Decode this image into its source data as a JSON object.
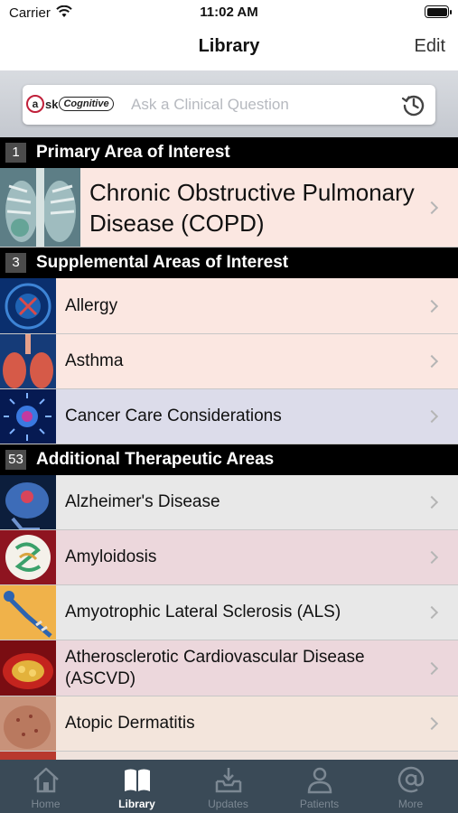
{
  "status_bar": {
    "carrier": "Carrier",
    "time": "11:02 AM"
  },
  "nav": {
    "title": "Library",
    "edit_label": "Edit"
  },
  "search": {
    "logo_prefix": "sk",
    "logo_badge": "Cognitive",
    "placeholder": "Ask a Clinical Question"
  },
  "sections": [
    {
      "count": "1",
      "title": "Primary Area of Interest",
      "items": [
        {
          "label": "Chronic Obstructive Pulmonary Disease (COPD)",
          "bg": "#fbe7e1"
        }
      ]
    },
    {
      "count": "3",
      "title": "Supplemental Areas of Interest",
      "items": [
        {
          "label": "Allergy",
          "bg": "#fbe7e1"
        },
        {
          "label": "Asthma",
          "bg": "#fbe7e1"
        },
        {
          "label": "Cancer Care Considerations",
          "bg": "#dcdcea"
        }
      ]
    },
    {
      "count": "53",
      "title": "Additional Therapeutic Areas",
      "items": [
        {
          "label": "Alzheimer's Disease",
          "bg": "#e8e8e8"
        },
        {
          "label": "Amyloidosis",
          "bg": "#ecd7dc"
        },
        {
          "label": "Amyotrophic Lateral Sclerosis (ALS)",
          "bg": "#e8e8e8"
        },
        {
          "label": "Atherosclerotic Cardiovascular Disease (ASCVD)",
          "bg": "#ecd7dc"
        },
        {
          "label": "Atopic Dermatitis",
          "bg": "#f3e5dc"
        }
      ]
    }
  ],
  "tabs": [
    {
      "label": "Home",
      "icon": "home-icon"
    },
    {
      "label": "Library",
      "icon": "book-icon",
      "active": true
    },
    {
      "label": "Updates",
      "icon": "inbox-download-icon"
    },
    {
      "label": "Patients",
      "icon": "person-icon"
    },
    {
      "label": "More",
      "icon": "at-sign-icon"
    }
  ],
  "colors": {
    "tab_bar": "#3a4a57",
    "section_header": "#000000",
    "accent": "#c0203a"
  }
}
